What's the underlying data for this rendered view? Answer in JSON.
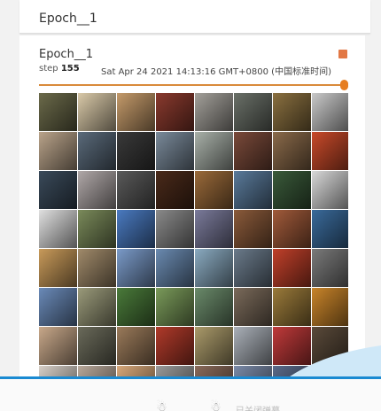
{
  "header": {
    "title": "Epoch__1"
  },
  "card": {
    "title": "Epoch__1",
    "step_label": "step",
    "step_value": "155",
    "timestamp": "Sat Apr 24 2021 14:13:16 GMT+0800 (中国标准时间)",
    "accent_color": "#e67e22",
    "slider_position_fraction": 1.0
  },
  "grid": {
    "rows": 8,
    "cols": 8,
    "tiles": [
      "#6b6a4a",
      "#d9c9a8",
      "#c49a6a",
      "#8a3a2e",
      "#a3a09a",
      "#6a7068",
      "#8a7040",
      "#c9c9c9",
      "#b9a38a",
      "#5a6a7a",
      "#3a3a3a",
      "#7a8a9a",
      "#a8b0a8",
      "#7a4a3a",
      "#8a6a4a",
      "#c84a2a",
      "#3a4a5a",
      "#b0a8a8",
      "#5a5a5a",
      "#4a2a1a",
      "#9a6a3a",
      "#5a7a9a",
      "#3a5a3a",
      "#d8d8d8",
      "#e0e0e0",
      "#7a8a5a",
      "#4a7ac0",
      "#8a8a8a",
      "#7a7a9a",
      "#8a5a3a",
      "#a05a3a",
      "#3a6a9a",
      "#c89a5a",
      "#a08a6a",
      "#7a9ac8",
      "#6a8ab0",
      "#8aaac0",
      "#6a7a8a",
      "#c0402a",
      "#7a7a7a",
      "#6a8ab8",
      "#9a9a7a",
      "#4a7a3a",
      "#7a9a5a",
      "#6a8a6a",
      "#7a6a5a",
      "#9a7a3a",
      "#c8842a",
      "#c8a88a",
      "#6a6a5a",
      "#9a7a5a",
      "#b03a2a",
      "#aa9a6a",
      "#aab0b8",
      "#c03a3a",
      "#5a4a3a",
      "#d8d0c8",
      "#b8a89a",
      "#d8a87a",
      "#9a9a9a",
      "#8a6a5a",
      "#7a8aa8",
      "#5a6a8a",
      "#a8a8a8"
    ]
  },
  "bottom": {
    "icons": "☃ ☃",
    "text": "已关闭弹幕"
  }
}
